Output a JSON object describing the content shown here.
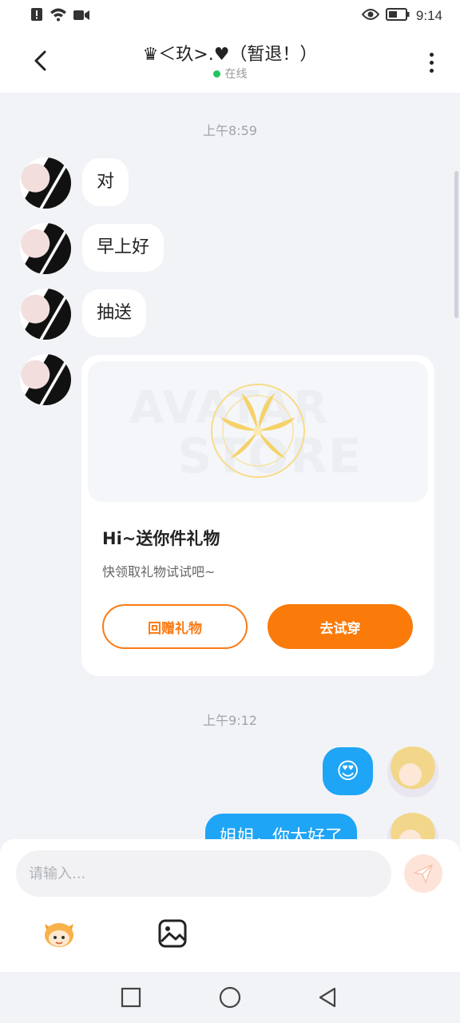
{
  "status_bar": {
    "time": "9:14",
    "icons": [
      "alert-icon",
      "wifi-icon",
      "video-icon",
      "eye-icon",
      "battery-icon"
    ]
  },
  "header": {
    "title": "♛＜玖>.♥（暂退！）",
    "status": "在线",
    "back_icon": "chevron-left-icon",
    "more_icon": "more-vertical-icon"
  },
  "chat": {
    "timestamps": [
      "上午8:59",
      "上午9:12"
    ],
    "messages": [
      {
        "side": "left",
        "text": "对"
      },
      {
        "side": "left",
        "text": "早上好"
      },
      {
        "side": "left",
        "text": "抽送"
      },
      {
        "side": "right",
        "emoji": "😍"
      },
      {
        "side": "right",
        "text": "姐姐，你太好了"
      }
    ],
    "gift_card": {
      "banner_word_1": "AVATAR",
      "banner_word_2": "STORE",
      "title": "Hi~送你件礼物",
      "subtitle": "快领取礼物试试吧~",
      "button_return": "回赠礼物",
      "button_try": "去试穿"
    }
  },
  "input": {
    "placeholder": "请输入...",
    "send_icon": "send-icon",
    "tools": [
      "mascot-icon",
      "image-icon"
    ]
  },
  "colors": {
    "accent_orange": "#fa7a0a",
    "bubble_blue": "#1fa5f5",
    "online_green": "#22c55e",
    "background": "#f2f3f7"
  },
  "nav": [
    "recent-apps-icon",
    "home-icon",
    "back-icon"
  ]
}
